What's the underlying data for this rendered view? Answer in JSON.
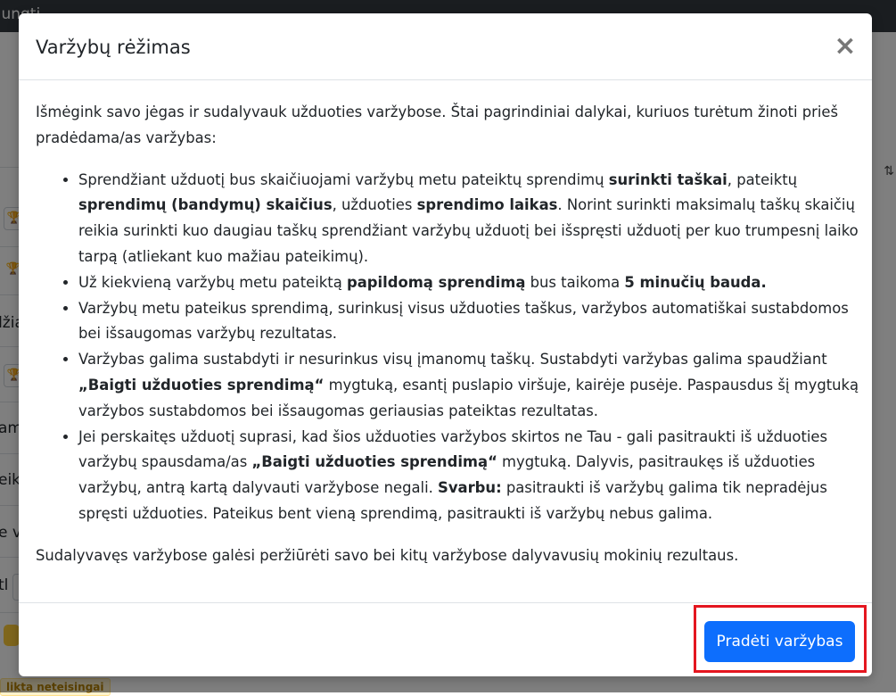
{
  "background": {
    "navbar_title": "ijungti",
    "fragments": [
      "džia",
      "am",
      "eik",
      "e v",
      "tl"
    ],
    "badge": "likta neteisingai"
  },
  "modal": {
    "title": "Varžybų rėžimas",
    "close_label": "×",
    "intro": "Išmėgink savo jėgas ir sudalyvauk užduoties varžybose. Štai pagrindiniai dalykai, kuriuos turėtum žinoti prieš pradėdama/as varžybas:",
    "rules": [
      {
        "t1": "Sprendžiant užduotį bus skaičiuojami varžybų metu pateiktų sprendimų ",
        "b1": "surinkti taškai",
        "t2": ", pateiktų ",
        "b2": "sprendimų (bandymų) skaičius",
        "t3": ", užduoties ",
        "b3": "sprendimo laikas",
        "t4": ". Norint surinkti maksimalų taškų skaičių reikia surinkti kuo daugiau taškų sprendžiant varžybų užduotį bei išspręsti užduotį per kuo trumpesnį laiko tarpą (atliekant kuo mažiau pateikimų)."
      },
      {
        "t1": "Už kiekvieną varžybų metu pateiktą ",
        "b1": "papildomą sprendimą",
        "t2": " bus taikoma ",
        "b2": "5 minučių bauda."
      },
      {
        "t1": "Varžybų metu pateikus sprendimą, surinkusį visus užduoties taškus, varžybos automatiškai sustabdomos bei išsaugomas varžybų rezultatas."
      },
      {
        "t1": "Varžybas galima sustabdyti ir nesurinkus visų įmanomų taškų. Sustabdyti varžybas galima spaudžiant ",
        "b1": "„Baigti užduoties sprendimą“",
        "t2": " mygtuką, esantį puslapio viršuje, kairėje pusėje. Paspausdus šį mygtuką varžybos sustabdomos bei išsaugomas geriausias pateiktas rezultatas."
      },
      {
        "t1": "Jei perskaitęs užduotį suprasi, kad šios užduoties varžybos skirtos ne Tau - gali pasitraukti iš užduoties varžybų spausdama/as ",
        "b1": "„Baigti užduoties sprendimą“",
        "t2": " mygtuką. Dalyvis, pasitraukęs iš užduoties varžybų, antrą kartą dalyvauti varžybose negali. ",
        "b2": "Svarbu:",
        "t3": " pasitraukti iš varžybų galima tik nepradėjus spręsti užduoties. Pateikus bent vieną sprendimą, pasitraukti iš varžybų nebus galima."
      }
    ],
    "closing": "Sudalyvavęs varžybose galėsi peržiūrėti savo bei kitų varžybose dalyvavusių mokinių rezultaus.",
    "start_button": "Pradėti varžybas"
  },
  "colors": {
    "primary": "#0d6efd",
    "highlight": "#e4161f",
    "backdrop": "rgba(0,0,0,0.5)"
  }
}
